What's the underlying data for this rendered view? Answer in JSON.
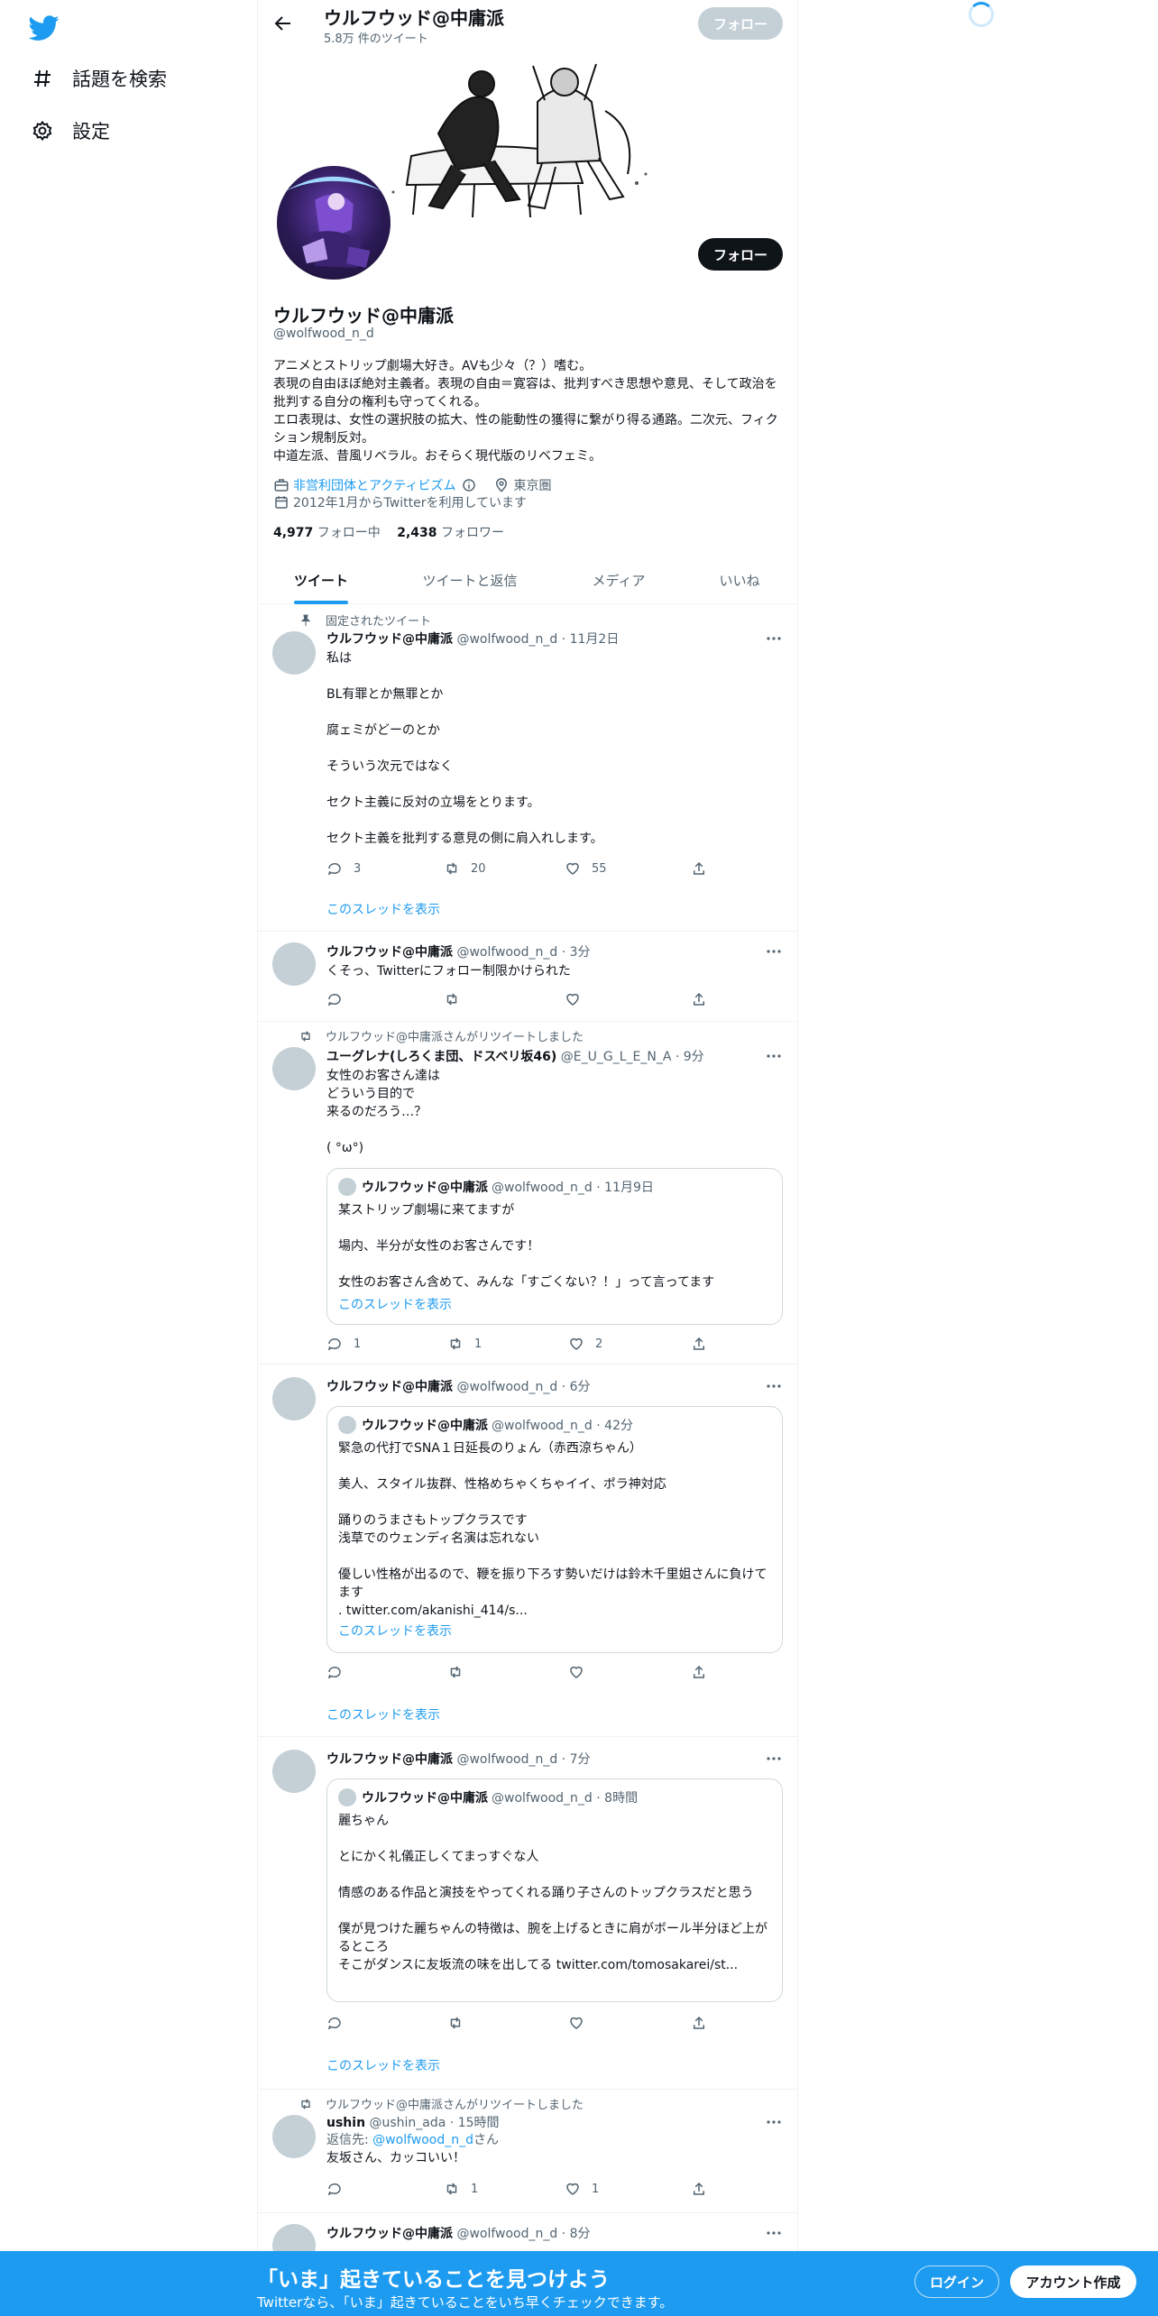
{
  "nav": {
    "explore_label": "話題を検索",
    "settings_label": "設定"
  },
  "header": {
    "title": "ウルフウッド@中庸派",
    "tweet_count": "5.8万 件のツイート",
    "follow_label": "フォロー"
  },
  "profile": {
    "name": "ウルフウッド@中庸派",
    "handle": "@wolfwood_n_d",
    "follow_label": "フォロー",
    "bio": "アニメとストリップ劇場大好き。AVも少々（？）嗜む。\n表現の自由ほぼ絶対主義者。表現の自由＝寛容は、批判すべき思想や意見、そして政治を批判する自分の権利も守ってくれる。\nエロ表現は、女性の選択肢の拡大、性の能動性の獲得に繋がり得る通路。二次元、フィクション規制反対。\n中道左派、昔風リベラル。おそらく現代版のリベフェミ。",
    "category": "非営利団体とアクティビズム",
    "location": "東京圏",
    "joined": "2012年1月からTwitterを利用しています",
    "following_count": "4,977",
    "following_label": "フォロー中",
    "followers_count": "2,438",
    "followers_label": "フォロワー"
  },
  "tabs": [
    {
      "label": "ツイート"
    },
    {
      "label": "ツイートと返信"
    },
    {
      "label": "メディア"
    },
    {
      "label": "いいね"
    }
  ],
  "tweets": [
    {
      "social": "固定されたツイート",
      "name": "ウルフウッド@中庸派",
      "meta": "@wolfwood_n_d · 11月2日",
      "body": "私は\n\nBL有罪とか無罪とか\n\n腐ェミがどーのとか\n\nそういう次元ではなく\n\nセクト主義に反対の立場をとります。\n\nセクト主義を批判する意見の側に肩入れします。",
      "replies": "3",
      "retweets": "20",
      "likes": "55",
      "thread": "このスレッドを表示"
    },
    {
      "name": "ウルフウッド@中庸派",
      "meta": "@wolfwood_n_d · 3分",
      "body": "くそっ、Twitterにフォロー制限かけられた"
    },
    {
      "social": "ウルフウッド@中庸派さんがリツイートしました",
      "name": "ユーグレナ(しろくま団、ドスベリ坂46)",
      "meta": "@E_U_G_L_E_N_A · 9分",
      "body": "女性のお客さん達は\nどういう目的で\n来るのだろう…？\n\n(   °ω°)",
      "quote": {
        "name": "ウルフウッド@中庸派",
        "meta": "@wolfwood_n_d · 11月9日",
        "body": "某ストリップ劇場に来てますが\n\n場内、半分が女性のお客さんです！\n\n女性のお客さん含めて、みんな「すごくない？！」って言ってます",
        "thread": "このスレッドを表示"
      },
      "replies": "1",
      "retweets": "1",
      "likes": "2"
    },
    {
      "name": "ウルフウッド@中庸派",
      "meta": "@wolfwood_n_d · 6分",
      "quote": {
        "name": "ウルフウッド@中庸派",
        "meta": "@wolfwood_n_d · 42分",
        "body": "緊急の代打でSNA１日延長のりょん（赤西涼ちゃん）\n\n美人、スタイル抜群、性格めちゃくちゃイイ、ポラ神対応\n\n踊りのうまさもトップクラスです\n浅草でのウェンディ名演は忘れない\n\n優しい性格が出るので、鞭を振り下ろす勢いだけは鈴木千里姐さんに負けてます\n. twitter.com/akanishi_414/s...",
        "thread": "このスレッドを表示"
      },
      "thread": "このスレッドを表示"
    },
    {
      "name": "ウルフウッド@中庸派",
      "meta": "@wolfwood_n_d · 7分",
      "quote": {
        "name": "ウルフウッド@中庸派",
        "meta": "@wolfwood_n_d · 8時間",
        "body": "麗ちゃん\n\nとにかく礼儀正しくてまっすぐな人\n\n情感のある作品と演技をやってくれる踊り子さんのトップクラスだと思う\n\n僕が見つけた麗ちゃんの特徴は、腕を上げるときに肩がボール半分ほど上がるところ\nそこがダンスに友坂流の味を出してる twitter.com/tomosakarei/st..."
      },
      "thread": "このスレッドを表示"
    },
    {
      "social": "ウルフウッド@中庸派さんがリツイートしました",
      "name": "ushin",
      "meta": "@ushin_ada · 15時間",
      "reply_prefix": "返信先: ",
      "reply_to": "@wolfwood_n_d",
      "reply_suffix": "さん",
      "body": "友坂さん、カッコいい！",
      "retweets": "1",
      "likes": "1"
    },
    {
      "name": "ウルフウッド@中庸派",
      "meta": "@wolfwood_n_d · 8分"
    }
  ],
  "bottom_bar": {
    "title": "「いま」起きていることを見つけよう",
    "subtitle": "Twitterなら、「いま」起きていることをいち早くチェックできます。",
    "login_label": "ログイン",
    "signup_label": "アカウント作成"
  },
  "colors": {
    "accent": "#1d9bf0",
    "text": "#0f1419",
    "muted": "#536471"
  }
}
